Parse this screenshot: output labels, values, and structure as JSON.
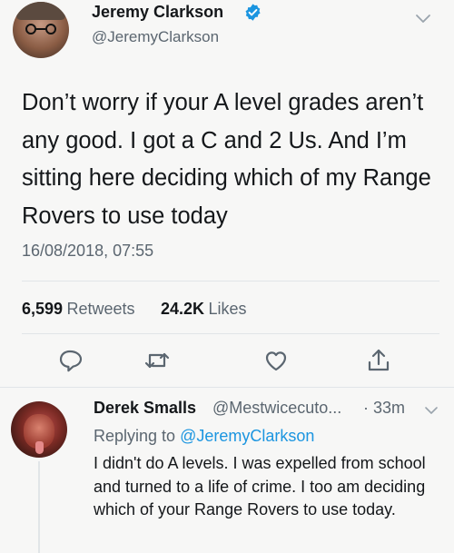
{
  "tweet": {
    "author_name": "Jeremy Clarkson",
    "author_handle": "@JeremyClarkson",
    "text": "Don’t worry if your A level grades aren’t any good. I got a C and 2 Us. And I’m sitting here deciding which of my Range Rovers to use today",
    "timestamp": "16/08/2018, 07:55",
    "retweets_count": "6,599",
    "retweets_label": "Retweets",
    "likes_count": "24.2K",
    "likes_label": "Likes"
  },
  "reply": {
    "author_name": "Derek Smalls",
    "author_handle": "@Mestwicecuto...",
    "time_sep": "·",
    "time": "33m",
    "replying_prefix": "Replying to",
    "replying_to": "@JeremyClarkson",
    "text": "I didn't do A levels. I was expelled from school and turned to a life of crime. I too am deciding which of your Range Rovers to use today."
  },
  "colors": {
    "accent": "#1b95e0",
    "text": "#14171a",
    "muted": "#5b6670",
    "background": "#f7f7f6"
  },
  "icons": [
    "verified-badge-icon",
    "chevron-down-icon",
    "reply-icon",
    "retweet-icon",
    "like-icon",
    "share-icon"
  ]
}
